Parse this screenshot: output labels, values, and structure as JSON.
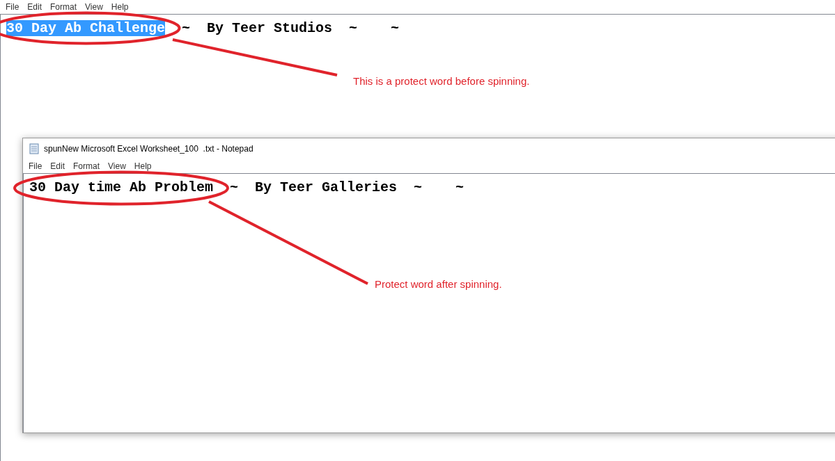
{
  "window_1": {
    "menu": [
      "File",
      "Edit",
      "Format",
      "View",
      "Help"
    ],
    "text": [
      {
        "text": "30 Day Ab Challenge",
        "selected": true
      },
      {
        "text": "~  By Teer Studios  ~    ~",
        "selected": false
      }
    ]
  },
  "window_2": {
    "title": "spunNew Microsoft Excel Worksheet_100  .txt - Notepad",
    "menu": [
      "File",
      "Edit",
      "Format",
      "View",
      "Help"
    ],
    "text": [
      {
        "text": "30 Day time Ab Problem",
        "selected": false
      },
      {
        "text": "~  By Teer Galleries  ~    ~",
        "selected": false
      }
    ]
  },
  "annotations": [
    {
      "text": "This is a protect word before spinning."
    },
    {
      "text": "Protect word after spinning."
    }
  ]
}
